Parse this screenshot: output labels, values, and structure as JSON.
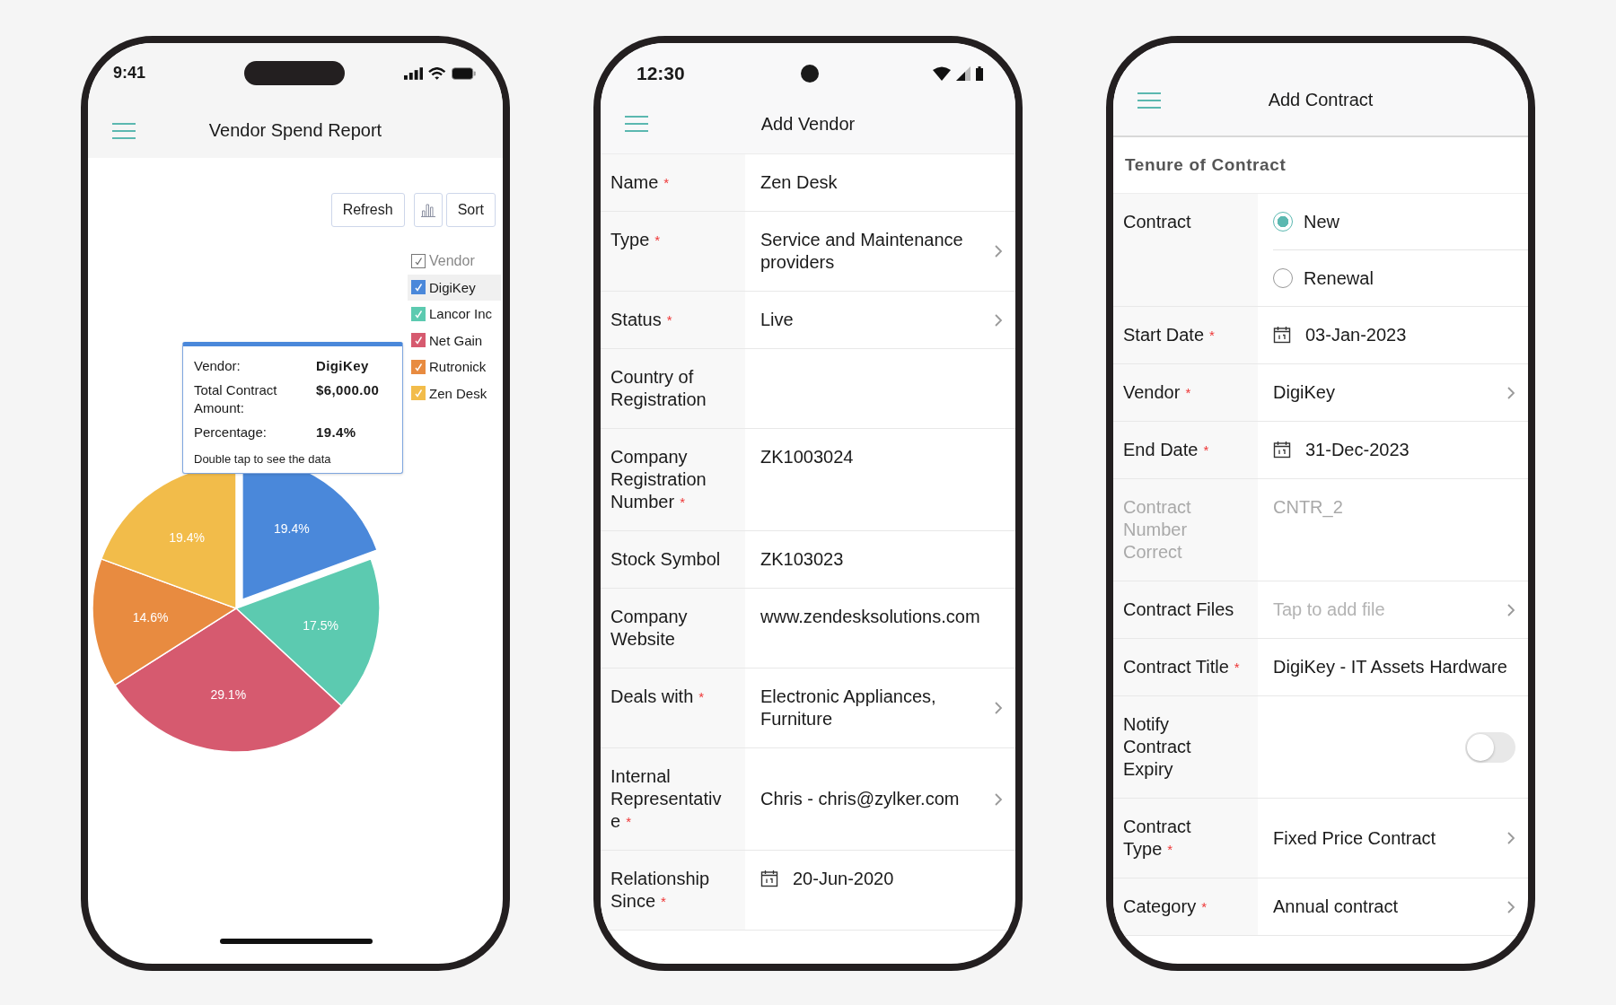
{
  "report_screen": {
    "status_bar": {
      "time": "9:41"
    },
    "header": {
      "title": "Vendor Spend Report"
    },
    "toolbar": [
      {
        "kind": "text",
        "label": "Refresh"
      },
      {
        "kind": "chart"
      },
      {
        "kind": "text",
        "label": "Sort"
      }
    ],
    "legend": {
      "title": {
        "label": "Vendor",
        "checked": true
      },
      "items": [
        {
          "color": "#4a88da",
          "checked": true,
          "selected": true
        },
        {
          "color": "#5ccab0",
          "checked": true,
          "selected": false
        },
        {
          "color": "#d65a6f",
          "checked": true,
          "selected": false
        },
        {
          "color": "#e88b40",
          "checked": true,
          "selected": false
        },
        {
          "color": "#f2bc4a",
          "checked": true,
          "selected": false
        }
      ]
    },
    "tooltip": {
      "rows": [
        {
          "label": "Vendor:",
          "value": "DigiKey"
        },
        {
          "label": "Total Contract Amount:",
          "value": "$6,000.00"
        },
        {
          "label": "Percentage:",
          "value": "19.4%"
        }
      ],
      "hint": "Double tap to see the data"
    },
    "chart_data": {
      "type": "pie",
      "categories": [
        "DigiKey",
        "Lancor Inc",
        "Net Gain",
        "Rutronick",
        "Zen Desk"
      ],
      "values": [
        19.4,
        17.5,
        29.1,
        14.6,
        19.4
      ],
      "value_labels": [
        "19.4%",
        "17.5%",
        "29.1%",
        "14.6%",
        "19.4%"
      ]
    }
  },
  "vendor_screen": {
    "status_bar": {
      "time": "12:30"
    },
    "header": {
      "title": "Add Vendor"
    },
    "fields": [
      {
        "label": "Name",
        "required_mark": "*",
        "kind": "text",
        "value": "Zen Desk"
      },
      {
        "label": "Type",
        "required_mark": "*",
        "kind": "picker",
        "value": "Service and Maintenance providers"
      },
      {
        "label": "Status",
        "required_mark": "*",
        "kind": "picker",
        "value": "Live"
      },
      {
        "label": "Country of Registration",
        "kind": "text"
      },
      {
        "label": "Company Registration Number",
        "required_mark": "*",
        "kind": "text",
        "value": "ZK1003024"
      },
      {
        "label": "Stock Symbol",
        "kind": "text",
        "value": "ZK103023"
      },
      {
        "label": "Company Website",
        "kind": "text",
        "value": "www.zendesksolutions.com"
      },
      {
        "label": "Deals with",
        "required_mark": "*",
        "kind": "picker",
        "value": "Electronic Appliances, Furniture"
      },
      {
        "label": "Internal Representative",
        "required_mark": "*",
        "kind": "picker",
        "value": "Chris - chris@zylker.com"
      },
      {
        "label": "Relationship Since",
        "required_mark": "*",
        "kind": "date",
        "value": "20-Jun-2020"
      }
    ]
  },
  "contract_screen": {
    "header": {
      "title": "Add Contract"
    },
    "section": "Tenure of Contract",
    "fields": [
      {
        "label": "Contract",
        "disabled": false,
        "kind": "radio",
        "options": [
          {
            "label": "New",
            "selected": true
          },
          {
            "label": "Renewal",
            "selected": false
          }
        ]
      },
      {
        "label": "Start Date",
        "required_mark": "*",
        "disabled": false,
        "kind": "date",
        "value": "03-Jan-2023"
      },
      {
        "label": "Vendor",
        "required_mark": "*",
        "disabled": false,
        "kind": "picker",
        "value": "DigiKey"
      },
      {
        "label": "End Date",
        "required_mark": "*",
        "disabled": false,
        "kind": "date",
        "value": "31-Dec-2023"
      },
      {
        "label": "Contract Number Correct",
        "disabled": true,
        "kind": "text",
        "value": "CNTR_2"
      },
      {
        "label": "Contract Files",
        "disabled": false,
        "kind": "file",
        "placeholder": "Tap to add file"
      },
      {
        "label": "Contract Title",
        "required_mark": "*",
        "disabled": false,
        "kind": "text",
        "value": "DigiKey - IT Assets Hardware"
      },
      {
        "label": "Notify Contract Expiry",
        "disabled": false,
        "kind": "toggle",
        "on": false
      },
      {
        "label": "Contract Type",
        "required_mark": "*",
        "disabled": false,
        "kind": "picker",
        "value": "Fixed Price Contract"
      },
      {
        "label": "Category",
        "required_mark": "*",
        "disabled": false,
        "kind": "picker",
        "value": "Annual contract"
      }
    ]
  }
}
